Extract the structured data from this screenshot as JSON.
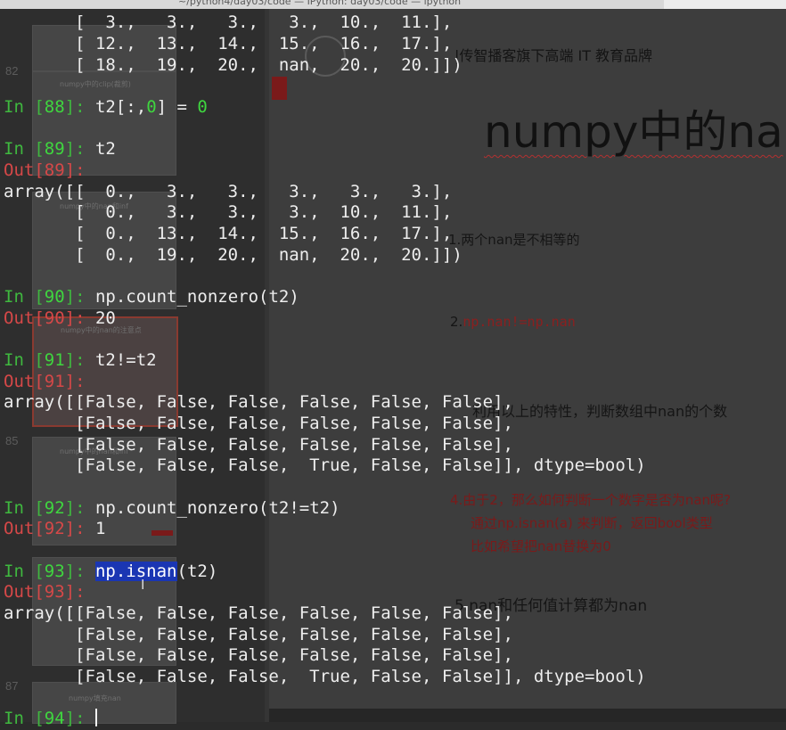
{
  "window": {
    "title": "~/python4/day03/code — IPython: day03/code — ipython"
  },
  "slides": {
    "thumb_numbers": [
      "82",
      "85",
      "87"
    ],
    "thumb_captions": [
      "numpy中的clip(裁剪)",
      "numpy中的nan和inf",
      "numpy中的nan的注意点",
      "numpy中的nan和inf",
      "numpy填充nan"
    ],
    "brand_text": "|传智播客旗下高端 IT 教育品牌",
    "title": "numpy中的na",
    "notes": {
      "n1": "1.两个nan是不相等的",
      "n2_num": "2.",
      "n2_code": "np.nan!=np.nan",
      "n3": "利用以上的特性，判断数组中nan的个数",
      "n4_l1": "4.由于2，那么如何判断一个数字是否为nan呢?",
      "n4_l2": "通过np.isnan(a) 来判断，返回bool类型",
      "n4_l3": "比如希望把nan替换为0",
      "n5": "5.nan和任何值计算都为nan"
    }
  },
  "terminal": {
    "prev_lines": [
      "       [  3.,   3.,   3.,   3.,  10.,  11.],",
      "       [ 12.,  13.,  14.,  15.,  16.,  17.],",
      "       [ 18.,  19.,  20.,  nan,  20.,  20.]])"
    ],
    "cell88": {
      "in": "In [",
      "num": "88",
      "close": "]: ",
      "code_a": "t2[:,",
      "code_zero": "0",
      "code_b": "] = ",
      "code_val": "0"
    },
    "cell89": {
      "in": "In [",
      "num": "89",
      "close": "]: ",
      "code": "t2",
      "out": "Out[89]:",
      "lines": [
        "array([[  0.,   3.,   3.,   3.,   3.,   3.],",
        "       [  0.,   3.,   3.,   3.,  10.,  11.],",
        "       [  0.,  13.,  14.,  15.,  16.,  17.],",
        "       [  0.,  19.,  20.,  nan,  20.,  20.]])"
      ]
    },
    "cell90": {
      "in": "In [",
      "num": "90",
      "close": "]: ",
      "code": "np.count_nonzero(t2)",
      "out": "Out[90]: ",
      "result": "20"
    },
    "cell91": {
      "in": "In [",
      "num": "91",
      "close": "]: ",
      "code": "t2!=t2",
      "out": "Out[91]:",
      "lines": [
        "array([[False, False, False, False, False, False],",
        "       [False, False, False, False, False, False],",
        "       [False, False, False, False, False, False],",
        "       [False, False, False,  True, False, False]], dtype=bool)"
      ]
    },
    "cell92": {
      "in": "In [",
      "num": "92",
      "close": "]: ",
      "code": "np.count_nonzero(t2!=t2)",
      "out": "Out[92]: ",
      "result": "1"
    },
    "cell93": {
      "in": "In [",
      "num": "93",
      "close": "]: ",
      "code_sel": "np.isnan",
      "code_rest": "(t2)",
      "out": "Out[93]:",
      "lines": [
        "array([[False, False, False, False, False, False],",
        "       [False, False, False, False, False, False],",
        "       [False, False, False, False, False, False],",
        "       [False, False, False,  True, False, False]], dtype=bool)"
      ]
    },
    "cell94": {
      "in": "In [",
      "num": "94",
      "close": "]: "
    }
  }
}
